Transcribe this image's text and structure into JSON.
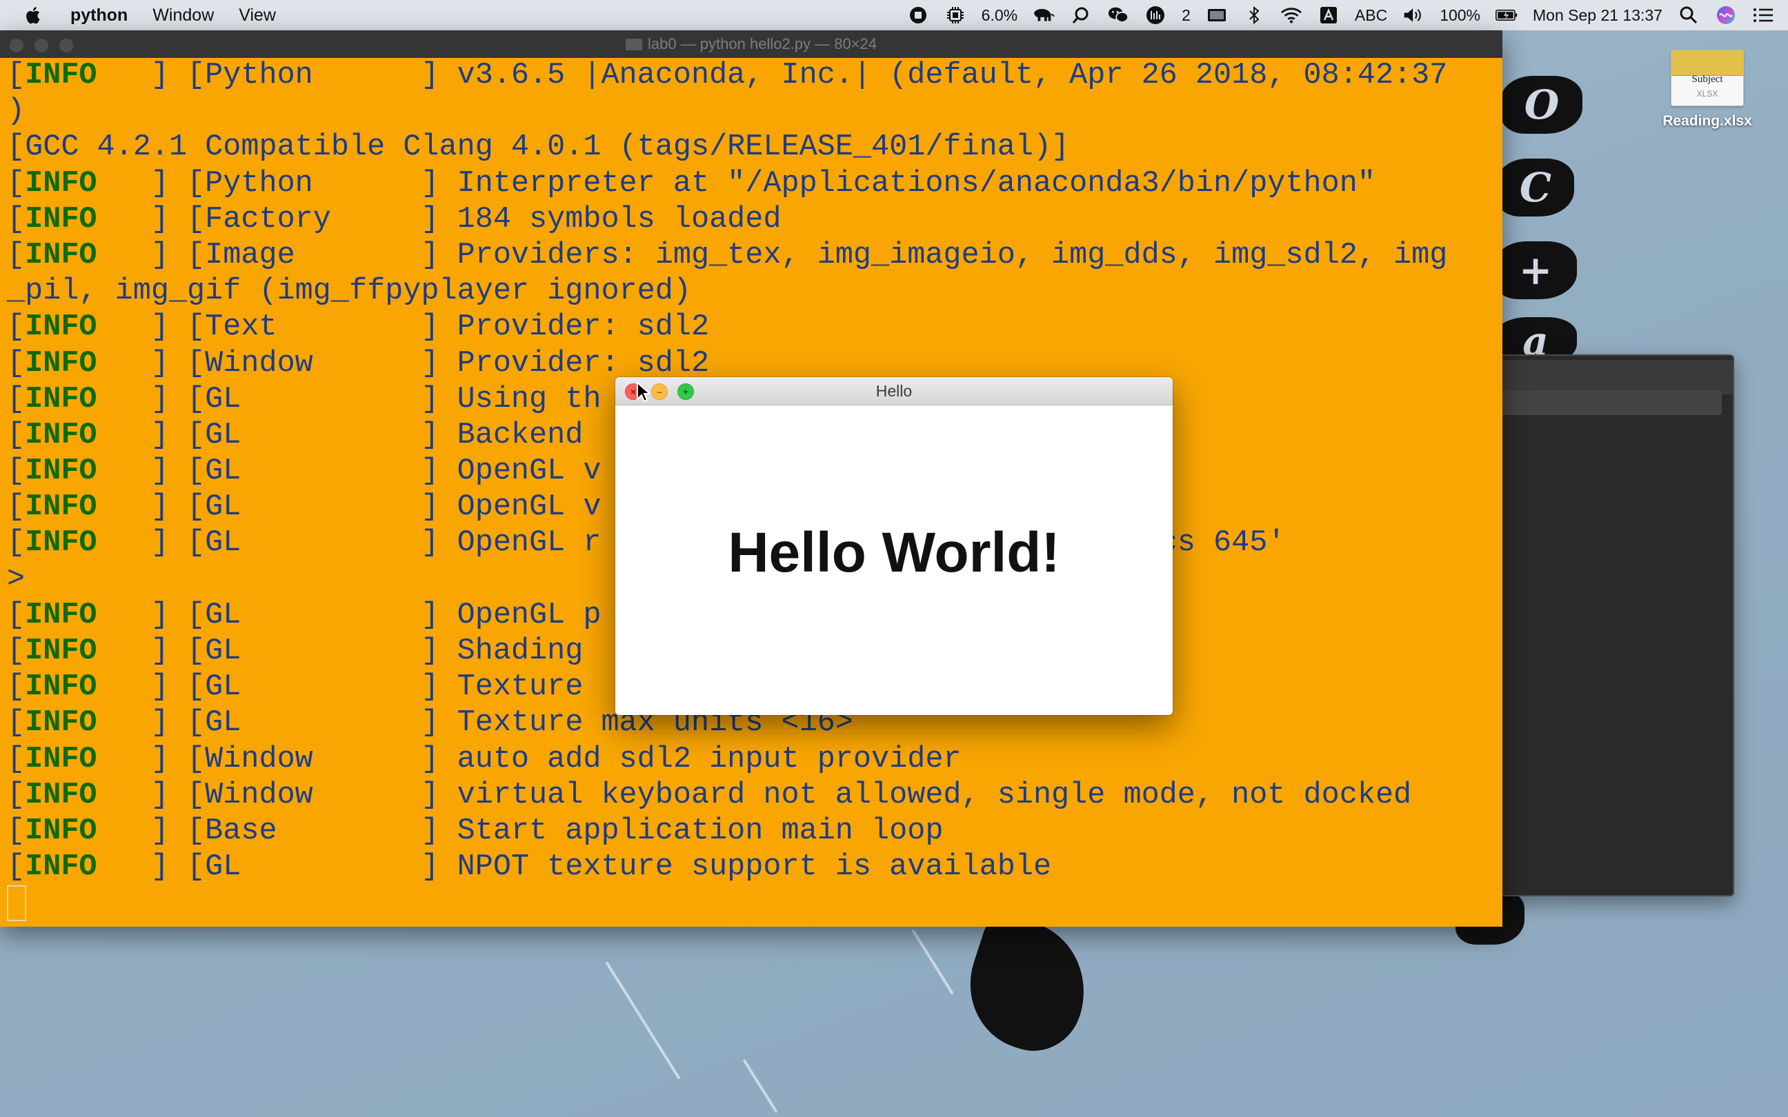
{
  "menubar": {
    "app_name": "python",
    "menus": [
      "Window",
      "View"
    ],
    "cpu": "6.0%",
    "badge_count": "2",
    "input_source": "ABC",
    "battery": "100%",
    "clock": "Mon Sep 21 13:37"
  },
  "desktop": {
    "file": {
      "name": "Reading.xlsx",
      "icon_title": "Subject",
      "icon_type": "XLSX"
    },
    "decor_letters": [
      "O",
      "C",
      "+",
      "a"
    ]
  },
  "terminal": {
    "title": "lab0 — python hello2.py — 80×24",
    "lines": [
      {
        "tag": "[INFO   ]",
        "text": " [Python      ] v3.6.5 |Anaconda, Inc.| (default, Apr 26 2018, 08:42:37"
      },
      {
        "tag": "",
        "text": ")"
      },
      {
        "tag": "",
        "text": "[GCC 4.2.1 Compatible Clang 4.0.1 (tags/RELEASE_401/final)]"
      },
      {
        "tag": "[INFO   ]",
        "text": " [Python      ] Interpreter at \"/Applications/anaconda3/bin/python\""
      },
      {
        "tag": "[INFO   ]",
        "text": " [Factory     ] 184 symbols loaded"
      },
      {
        "tag": "[INFO   ]",
        "text": " [Image       ] Providers: img_tex, img_imageio, img_dds, img_sdl2, img"
      },
      {
        "tag": "",
        "text": "_pil, img_gif (img_ffpyplayer ignored)"
      },
      {
        "tag": "[INFO   ]",
        "text": " [Text        ] Provider: sdl2"
      },
      {
        "tag": "[INFO   ]",
        "text": " [Window      ] Provider: sdl2"
      },
      {
        "tag": "[INFO   ]",
        "text": " [GL          ] Using th                    em"
      },
      {
        "tag": "[INFO   ]",
        "text": " [GL          ] Backend"
      },
      {
        "tag": "[INFO   ]",
        "text": " [GL          ] OpenGL v"
      },
      {
        "tag": "[INFO   ]",
        "text": " [GL          ] OpenGL v"
      },
      {
        "tag": "[INFO   ]",
        "text": " [GL          ] OpenGL r                    Plus Graphics 645'"
      },
      {
        "tag": "",
        "text": ">"
      },
      {
        "tag": "[INFO   ]",
        "text": " [GL          ] OpenGL p"
      },
      {
        "tag": "[INFO   ]",
        "text": " [GL          ] Shading"
      },
      {
        "tag": "[INFO   ]",
        "text": " [GL          ] Texture"
      },
      {
        "tag": "[INFO   ]",
        "text": " [GL          ] Texture max units <16>"
      },
      {
        "tag": "[INFO   ]",
        "text": " [Window      ] auto add sdl2 input provider"
      },
      {
        "tag": "[INFO   ]",
        "text": " [Window      ] virtual keyboard not allowed, single mode, not docked"
      },
      {
        "tag": "[INFO   ]",
        "text": " [Base        ] Start application main loop"
      },
      {
        "tag": "[INFO   ]",
        "text": " [GL          ] NPOT texture support is available"
      }
    ]
  },
  "hello_window": {
    "title": "Hello",
    "label": "Hello World!"
  },
  "colors": {
    "terminal_bg": "#f9a602",
    "terminal_text": "#1d3c86",
    "info_tag": "#0e6a0e",
    "close": "#fc605c",
    "minimize": "#fdbc40",
    "maximize": "#34c84a"
  },
  "icons": [
    "apple-icon",
    "record-icon",
    "cpu-icon",
    "elephant-icon",
    "magnifier-icon",
    "wechat-icon",
    "badge-icon",
    "display-icon",
    "bluetooth-icon",
    "wifi-icon",
    "input-source-icon",
    "volume-icon",
    "battery-icon",
    "search-icon",
    "siri-icon",
    "control-center-icon"
  ]
}
